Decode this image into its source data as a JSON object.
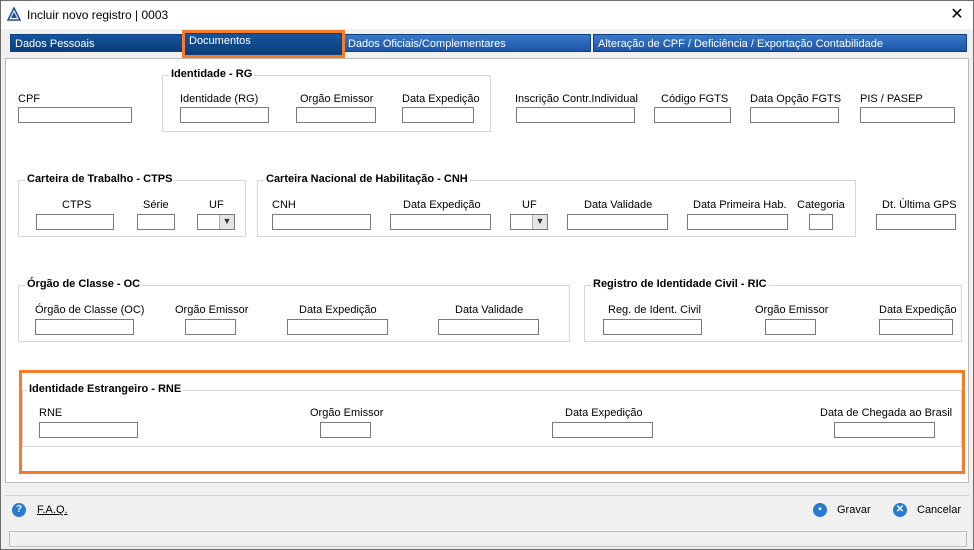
{
  "window": {
    "title": "Incluir novo registro | 0003"
  },
  "tabs": [
    "Dados Pessoais",
    "Documentos",
    "Dados Oficiais/Complementares",
    "Alteração de CPF / Deficiência / Exportação Contabilidade"
  ],
  "row1": {
    "cpf": "CPF",
    "rg_group": "Identidade - RG",
    "rg": "Identidade (RG)",
    "rg_orgao": "Orgão Emissor",
    "rg_data": "Data Expedição",
    "inscricao": "Inscrição Contr.Individual",
    "fgts": "Código FGTS",
    "data_opcao": "Data Opção FGTS",
    "pis": "PIS / PASEP"
  },
  "row2": {
    "ctps_group": "Carteira de Trabalho - CTPS",
    "ctps": "CTPS",
    "serie": "Série",
    "uf": "UF",
    "cnh_group": "Carteira Nacional de Habilitação - CNH",
    "cnh": "CNH",
    "cnh_data": "Data Expedição",
    "cnh_uf": "UF",
    "cnh_validade": "Data Validade",
    "cnh_primeira": "Data Primeira Hab.",
    "categoria": "Categoria",
    "gps": "Dt. Última GPS"
  },
  "row3": {
    "oc_group": "Órgão de Classe - OC",
    "oc": "Órgão de Classe (OC)",
    "oc_orgao": "Orgão Emissor",
    "oc_data": "Data Expedição",
    "oc_validade": "Data Validade",
    "ric_group": "Registro de Identidade Civil - RIC",
    "ric": "Reg. de Ident. Civil",
    "ric_orgao": "Orgão Emissor",
    "ric_data": "Data Expedição"
  },
  "row4": {
    "rne_group": "Identidade Estrangeiro - RNE",
    "rne": "RNE",
    "rne_orgao": "Orgão Emissor",
    "rne_data": "Data Expedição",
    "chegada": "Data de Chegada ao Brasil"
  },
  "footer": {
    "faq": "F.A.Q.",
    "save": "Gravar",
    "cancel": "Cancelar"
  },
  "colors": {
    "highlight": "#f47c2a",
    "tab": "#1b56a8"
  }
}
